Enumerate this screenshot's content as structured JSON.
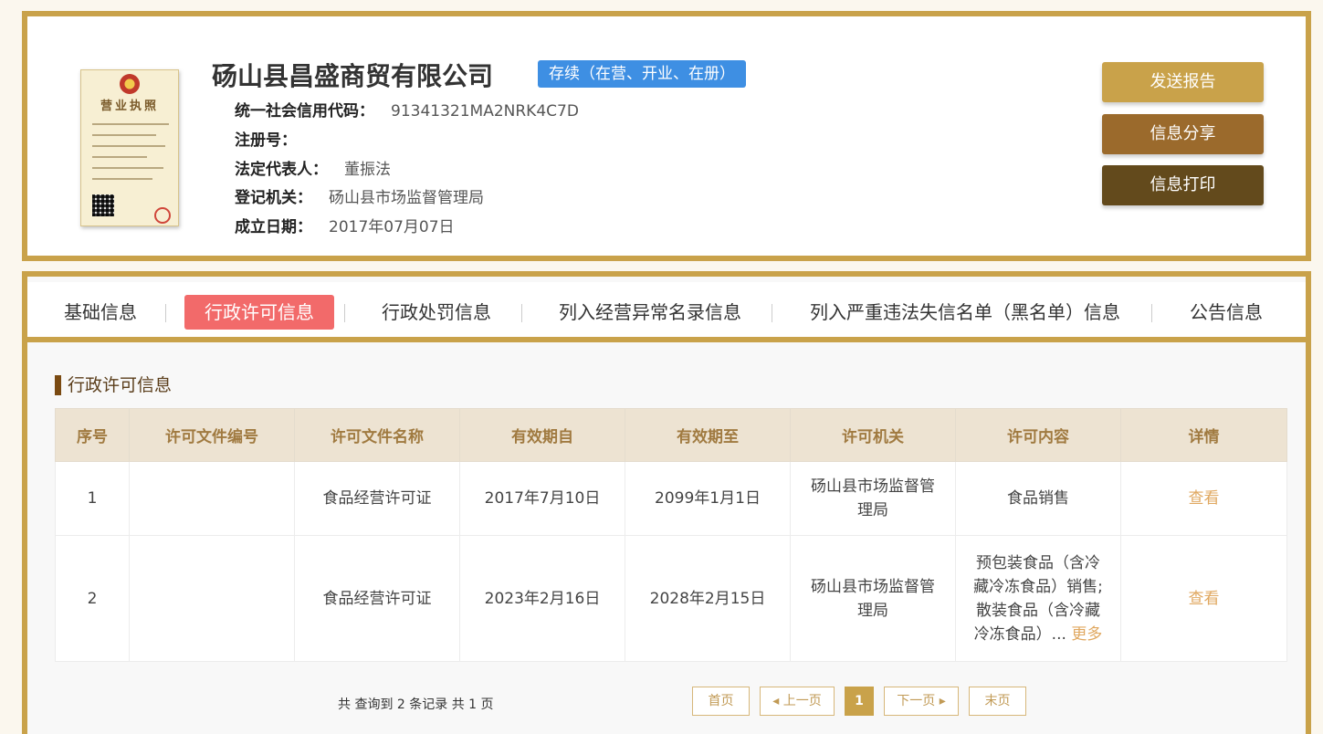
{
  "company": {
    "name": "砀山县昌盛商贸有限公司",
    "status": "存续（在营、开业、在册）",
    "license_title": "营业执照",
    "fields": [
      {
        "label": "统一社会信用代码：",
        "value": "91341321MA2NRK4C7D"
      },
      {
        "label": "注册号：",
        "value": ""
      },
      {
        "label": "法定代表人：",
        "value": "董振法"
      },
      {
        "label": "登记机关：",
        "value": "砀山县市场监督管理局"
      },
      {
        "label": "成立日期：",
        "value": "2017年07月07日"
      }
    ]
  },
  "actions": {
    "report": "发送报告",
    "share": "信息分享",
    "print": "信息打印"
  },
  "tabs": [
    {
      "label": "基础信息",
      "active": false
    },
    {
      "label": "行政许可信息",
      "active": true
    },
    {
      "label": "行政处罚信息",
      "active": false
    },
    {
      "label": "列入经营异常名录信息",
      "active": false
    },
    {
      "label": "列入严重违法失信名单（黑名单）信息",
      "active": false
    },
    {
      "label": "公告信息",
      "active": false
    }
  ],
  "section": {
    "title": "行政许可信息",
    "columns": [
      "序号",
      "许可文件编号",
      "许可文件名称",
      "有效期自",
      "有效期至",
      "许可机关",
      "许可内容",
      "详情"
    ],
    "rows": [
      {
        "no": "1",
        "doc_no": "",
        "doc_name": "食品经营许可证",
        "from": "2017年7月10日",
        "to": "2099年1月1日",
        "authority": "砀山县市场监督管理局",
        "content": "食品销售",
        "more": "",
        "detail": "查看"
      },
      {
        "no": "2",
        "doc_no": "",
        "doc_name": "食品经营许可证",
        "from": "2023年2月16日",
        "to": "2028年2月15日",
        "authority": "砀山县市场监督管理局",
        "content": "预包装食品（含冷藏冷冻食品）销售;散装食品（含冷藏冷冻食品）...",
        "more": "更多",
        "detail": "查看"
      }
    ]
  },
  "pagination": {
    "summary": "共 查询到 2 条记录 共 1 页",
    "first": "首页",
    "prev": "◂ 上一页",
    "current": "1",
    "next": "下一页 ▸",
    "last": "末页"
  },
  "colors": {
    "gold": "#c9a24a",
    "status_blue": "#3e8fe3",
    "active_tab": "#f26a6a",
    "link": "#e0a860"
  }
}
